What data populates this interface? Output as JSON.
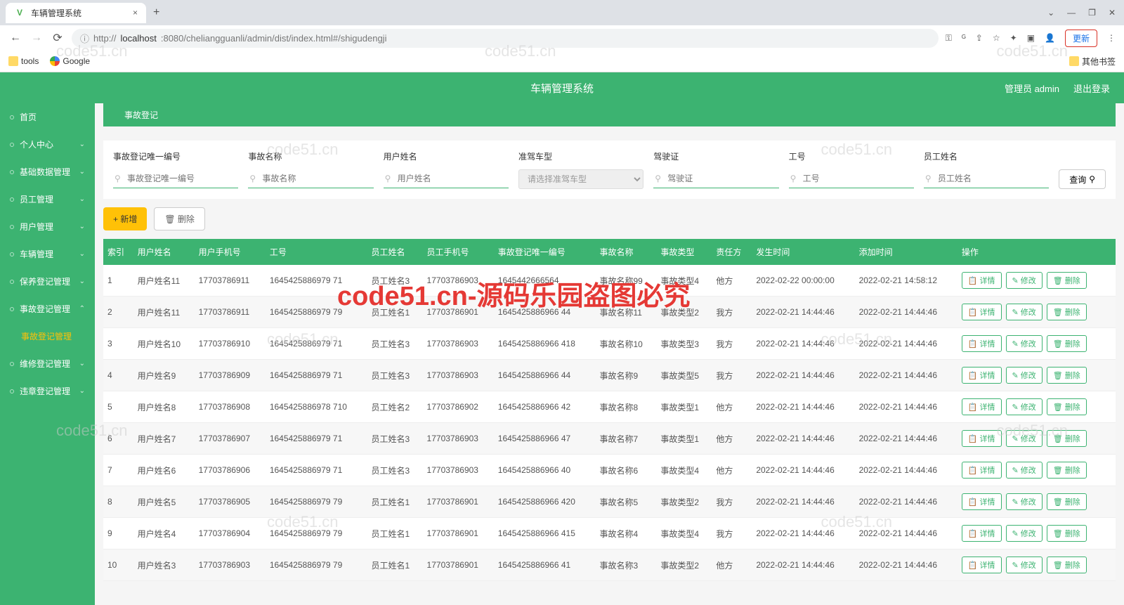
{
  "browser": {
    "tab_title": "车辆管理系统",
    "url_prefix": "localhost",
    "url_rest": ":8080/cheliangguanli/admin/dist/index.html#/shigudengji",
    "url_scheme": "http://",
    "bookmarks": {
      "tools": "tools",
      "google": "Google",
      "other": "其他书签"
    },
    "update": "更新"
  },
  "header": {
    "title": "车辆管理系统",
    "user": "管理员 admin",
    "logout": "退出登录"
  },
  "sidebar": [
    {
      "label": "首页",
      "arrow": ""
    },
    {
      "label": "个人中心",
      "arrow": "⌄"
    },
    {
      "label": "基础数据管理",
      "arrow": "⌄"
    },
    {
      "label": "员工管理",
      "arrow": "⌄"
    },
    {
      "label": "用户管理",
      "arrow": "⌄"
    },
    {
      "label": "车辆管理",
      "arrow": "⌄"
    },
    {
      "label": "保养登记管理",
      "arrow": "⌄"
    },
    {
      "label": "事故登记管理",
      "arrow": "⌃",
      "expanded": true
    },
    {
      "label": "事故登记管理",
      "sub": true
    },
    {
      "label": "维修登记管理",
      "arrow": "⌄"
    },
    {
      "label": "违章登记管理",
      "arrow": "⌄"
    }
  ],
  "breadcrumb": "事故登记",
  "search": {
    "fields": [
      {
        "label": "事故登记唯一编号",
        "placeholder": "事故登记唯一编号",
        "type": "input"
      },
      {
        "label": "事故名称",
        "placeholder": "事故名称",
        "type": "input"
      },
      {
        "label": "用户姓名",
        "placeholder": "用户姓名",
        "type": "input"
      },
      {
        "label": "准驾车型",
        "placeholder": "请选择准驾车型",
        "type": "select"
      },
      {
        "label": "驾驶证",
        "placeholder": "驾驶证",
        "type": "input"
      },
      {
        "label": "工号",
        "placeholder": "工号",
        "type": "input"
      },
      {
        "label": "员工姓名",
        "placeholder": "员工姓名",
        "type": "input"
      }
    ],
    "query_btn": "查询"
  },
  "actions": {
    "add": "+ 新增",
    "del": "删除"
  },
  "table": {
    "headers": [
      "索引",
      "用户姓名",
      "用户手机号",
      "工号",
      "员工姓名",
      "员工手机号",
      "事故登记唯一编号",
      "事故名称",
      "事故类型",
      "责任方",
      "发生时间",
      "添加时间",
      "操作"
    ],
    "ops": {
      "detail": "详情",
      "edit": "修改",
      "delete": "删除"
    },
    "rows": [
      {
        "c": [
          "1",
          "用户姓名11",
          "17703786911",
          "1645425886979 71",
          "员工姓名3",
          "17703786903",
          "1645442666564",
          "事故名称99",
          "事故类型4",
          "他方",
          "2022-02-22 00:00:00",
          "2022-02-21 14:58:12"
        ]
      },
      {
        "c": [
          "2",
          "用户姓名11",
          "17703786911",
          "1645425886979 79",
          "员工姓名1",
          "17703786901",
          "1645425886966 44",
          "事故名称11",
          "事故类型2",
          "我方",
          "2022-02-21 14:44:46",
          "2022-02-21 14:44:46"
        ]
      },
      {
        "c": [
          "3",
          "用户姓名10",
          "17703786910",
          "1645425886979 71",
          "员工姓名3",
          "17703786903",
          "1645425886966 418",
          "事故名称10",
          "事故类型3",
          "我方",
          "2022-02-21 14:44:46",
          "2022-02-21 14:44:46"
        ]
      },
      {
        "c": [
          "4",
          "用户姓名9",
          "17703786909",
          "1645425886979 71",
          "员工姓名3",
          "17703786903",
          "1645425886966 44",
          "事故名称9",
          "事故类型5",
          "我方",
          "2022-02-21 14:44:46",
          "2022-02-21 14:44:46"
        ]
      },
      {
        "c": [
          "5",
          "用户姓名8",
          "17703786908",
          "1645425886978 710",
          "员工姓名2",
          "17703786902",
          "1645425886966 42",
          "事故名称8",
          "事故类型1",
          "他方",
          "2022-02-21 14:44:46",
          "2022-02-21 14:44:46"
        ]
      },
      {
        "c": [
          "6",
          "用户姓名7",
          "17703786907",
          "1645425886979 71",
          "员工姓名3",
          "17703786903",
          "1645425886966 47",
          "事故名称7",
          "事故类型1",
          "他方",
          "2022-02-21 14:44:46",
          "2022-02-21 14:44:46"
        ]
      },
      {
        "c": [
          "7",
          "用户姓名6",
          "17703786906",
          "1645425886979 71",
          "员工姓名3",
          "17703786903",
          "1645425886966 40",
          "事故名称6",
          "事故类型4",
          "他方",
          "2022-02-21 14:44:46",
          "2022-02-21 14:44:46"
        ]
      },
      {
        "c": [
          "8",
          "用户姓名5",
          "17703786905",
          "1645425886979 79",
          "员工姓名1",
          "17703786901",
          "1645425886966 420",
          "事故名称5",
          "事故类型2",
          "我方",
          "2022-02-21 14:44:46",
          "2022-02-21 14:44:46"
        ]
      },
      {
        "c": [
          "9",
          "用户姓名4",
          "17703786904",
          "1645425886979 79",
          "员工姓名1",
          "17703786901",
          "1645425886966 415",
          "事故名称4",
          "事故类型4",
          "我方",
          "2022-02-21 14:44:46",
          "2022-02-21 14:44:46"
        ]
      },
      {
        "c": [
          "10",
          "用户姓名3",
          "17703786903",
          "1645425886979 79",
          "员工姓名1",
          "17703786901",
          "1645425886966 41",
          "事故名称3",
          "事故类型2",
          "他方",
          "2022-02-21 14:44:46",
          "2022-02-21 14:44:46"
        ]
      }
    ]
  },
  "watermark": "code51.cn",
  "big_red": "code51.cn-源码乐园盗图必究"
}
